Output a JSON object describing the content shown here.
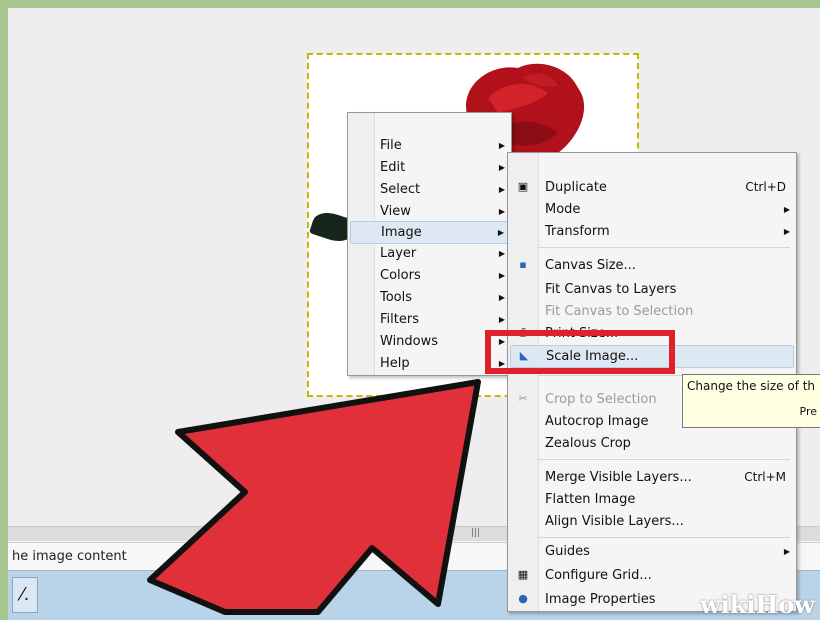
{
  "status": {
    "text": "he image content"
  },
  "main_menu": {
    "items": [
      {
        "label": "File"
      },
      {
        "label": "Edit"
      },
      {
        "label": "Select"
      },
      {
        "label": "View"
      },
      {
        "label": "Image"
      },
      {
        "label": "Layer"
      },
      {
        "label": "Colors"
      },
      {
        "label": "Tools"
      },
      {
        "label": "Filters"
      },
      {
        "label": "Windows"
      },
      {
        "label": "Help"
      }
    ],
    "highlighted": "Image"
  },
  "image_menu": {
    "duplicate": {
      "label": "Duplicate",
      "shortcut": "Ctrl+D"
    },
    "mode": {
      "label": "Mode"
    },
    "transform": {
      "label": "Transform"
    },
    "canvas_size": {
      "label": "Canvas Size..."
    },
    "fit_canvas_layers": {
      "label": "Fit Canvas to Layers"
    },
    "fit_canvas_selection": {
      "label": "Fit Canvas to Selection"
    },
    "print_size": {
      "label": "Print Size..."
    },
    "scale_image": {
      "label": "Scale Image..."
    },
    "crop_selection": {
      "label": "Crop to Selection"
    },
    "autocrop": {
      "label": "Autocrop Image"
    },
    "zealous": {
      "label": "Zealous Crop"
    },
    "merge_visible": {
      "label": "Merge Visible Layers...",
      "shortcut": "Ctrl+M"
    },
    "flatten": {
      "label": "Flatten Image"
    },
    "align_visible": {
      "label": "Align Visible Layers..."
    },
    "guides": {
      "label": "Guides"
    },
    "configure_grid": {
      "label": "Configure Grid..."
    },
    "image_properties": {
      "label": "Image Properties"
    }
  },
  "tooltip": {
    "line1": "Change the size of th",
    "line2": "Pre"
  },
  "watermark": {
    "text": "wikiHow"
  },
  "colors": {
    "highlight_box": "#e0202a",
    "arrow": "#e0303a",
    "tooltip_bg": "#ffffe1"
  }
}
